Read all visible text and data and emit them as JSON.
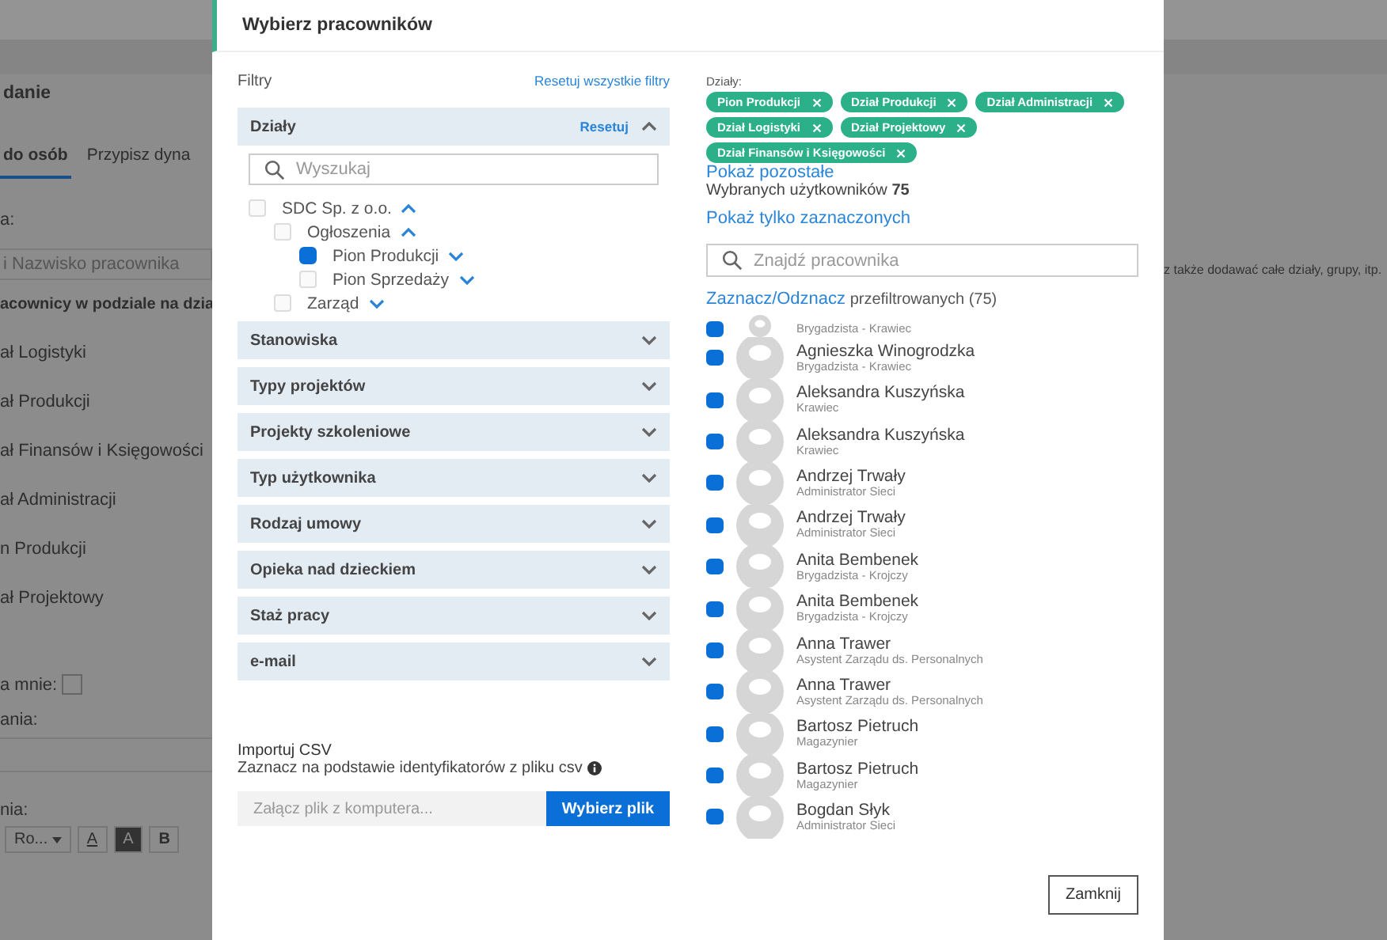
{
  "background_page": {
    "title": "danie",
    "tabs": [
      {
        "label": "do osób",
        "selected": true
      },
      {
        "label": "Przypisz dyna",
        "selected": false
      }
    ],
    "field_label": "a:",
    "name_field": {
      "placeholder": "i Nazwisko pracownika"
    },
    "section_title": "acownicy w podziale na dzia",
    "departments": [
      "ał Logistyki",
      "ał Produkcji",
      "ał Finansów i Księgowości",
      "ał Administracji",
      "n Produkcji",
      "ał Projektowy"
    ],
    "assign_me": {
      "label": "a mnie:",
      "checked": false
    },
    "label_2": "ania:",
    "label_3": "nia:",
    "toolbar": [
      {
        "kind": "dropdown",
        "label": "Ro..."
      },
      {
        "kind": "text-color",
        "label": "A"
      },
      {
        "kind": "highlight",
        "label": "A"
      },
      {
        "kind": "bold",
        "label": "B"
      }
    ],
    "hint": "z także dodawać całe działy, grupy, itp."
  },
  "modal": {
    "title": "Wybierz pracowników",
    "filters": {
      "title": "Filtry",
      "reset_all": "Resetuj wszystkie filtry",
      "sections": [
        {
          "label": "Działy",
          "expanded": true,
          "reset": "Resetuj",
          "search_placeholder": "Wyszukaj",
          "tree": [
            {
              "label": "SDC Sp. z o.o.",
              "checked": false,
              "expanded": true,
              "children": [
                {
                  "label": "Ogłoszenia",
                  "checked": false,
                  "expanded": true,
                  "children": [
                    {
                      "label": "Pion Produkcji",
                      "checked": true,
                      "expanded": false
                    },
                    {
                      "label": "Pion Sprzedaży",
                      "checked": false,
                      "expanded": false
                    }
                  ]
                },
                {
                  "label": "Zarząd",
                  "checked": false,
                  "expanded": false
                }
              ]
            }
          ]
        },
        {
          "label": "Stanowiska",
          "expanded": false
        },
        {
          "label": "Typy projektów",
          "expanded": false
        },
        {
          "label": "Projekty szkoleniowe",
          "expanded": false
        },
        {
          "label": "Typ użytkownika",
          "expanded": false
        },
        {
          "label": "Rodzaj umowy",
          "expanded": false
        },
        {
          "label": "Opieka nad dzieckiem",
          "expanded": false
        },
        {
          "label": "Staż pracy",
          "expanded": false
        },
        {
          "label": "e-mail",
          "expanded": false
        }
      ]
    },
    "csv": {
      "title": "Importuj CSV",
      "description": "Zaznacz na podstawie identyfikatorów z pliku csv",
      "file_placeholder": "Załącz plik z komputera...",
      "button": "Wybierz plik"
    },
    "selection": {
      "label": "Działy:",
      "tags": [
        "Pion Produkcji",
        "Dział Produkcji",
        "Dział Administracji",
        "Dział Logistyki",
        "Dział Projektowy",
        "Dział Finansów i Księgowości"
      ],
      "show_more": "Pokaż pozostałe",
      "selected_count": "Wybranych użytkowników **75**",
      "show_checked": "Pokaż tylko zaznaczonych",
      "search_placeholder": "Znajdź pracownika",
      "toggle_link": "Zaznacz/Odznacz",
      "toggle_rest": " przefiltrowanych (75)"
    },
    "employees": [
      {
        "role": "Brygadzista - Krawiec",
        "checked": true
      },
      {
        "name": "Agnieszka Winogrodzka",
        "role": "Brygadzista - Krawiec",
        "checked": true
      },
      {
        "name": "Aleksandra Kuszyńska",
        "role": "Krawiec",
        "checked": true
      },
      {
        "name": "Aleksandra Kuszyńska",
        "role": "Krawiec",
        "checked": true
      },
      {
        "name": "Andrzej Trwały",
        "role": "Administrator Sieci",
        "checked": true
      },
      {
        "name": "Andrzej Trwały",
        "role": "Administrator Sieci",
        "checked": true
      },
      {
        "name": "Anita Bembenek",
        "role": "Brygadzista - Krojczy",
        "checked": true
      },
      {
        "name": "Anita Bembenek",
        "role": "Brygadzista - Krojczy",
        "checked": true
      },
      {
        "name": "Anna Trawer",
        "role": "Asystent Zarządu ds. Personalnych",
        "checked": true
      },
      {
        "name": "Anna Trawer",
        "role": "Asystent Zarządu ds. Personalnych",
        "checked": true
      },
      {
        "name": "Bartosz Pietruch",
        "role": "Magazynier",
        "checked": true
      },
      {
        "name": "Bartosz Pietruch",
        "role": "Magazynier",
        "checked": true
      },
      {
        "name": "Bogdan Słyk",
        "role": "Administrator Sieci",
        "checked": true
      }
    ],
    "close_button": "Zamknij"
  }
}
